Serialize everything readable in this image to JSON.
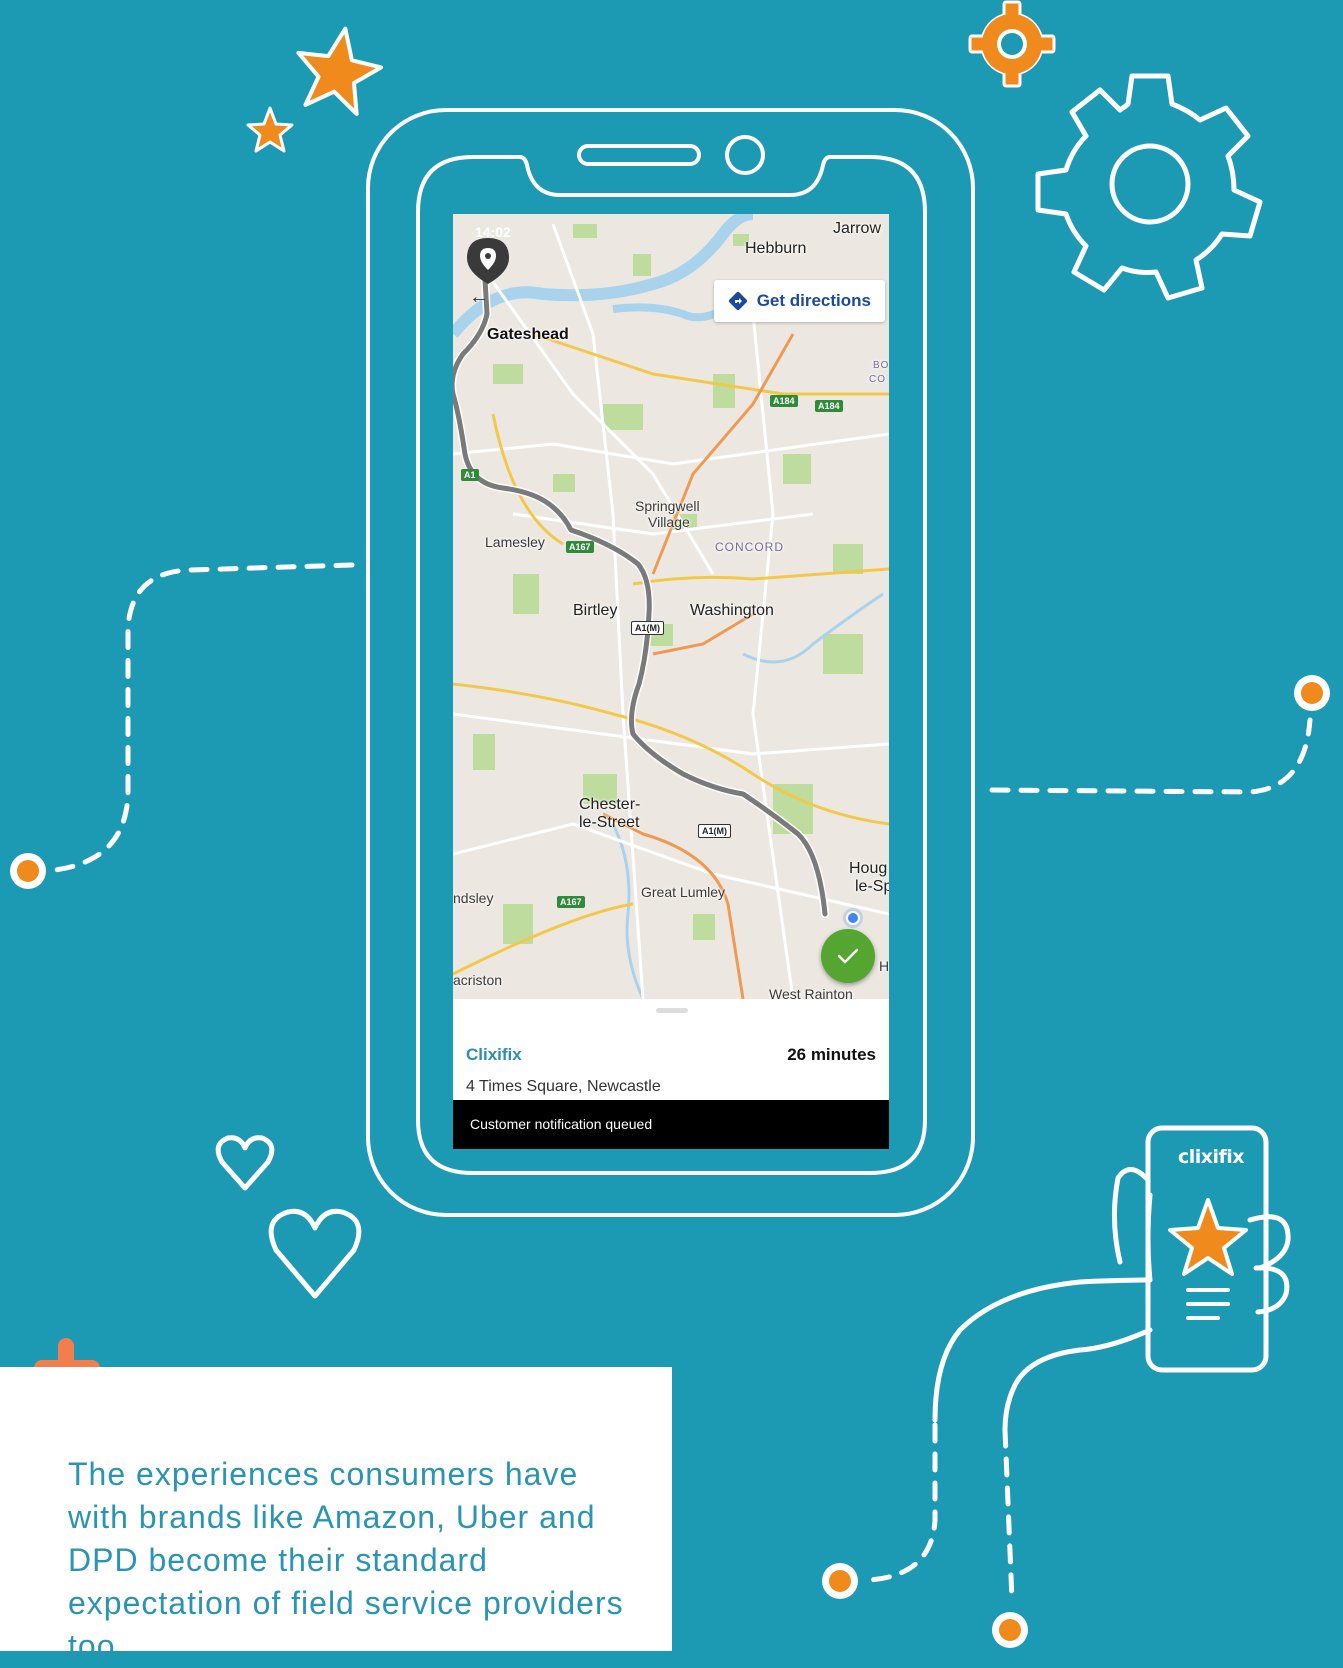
{
  "map": {
    "time": "14:02",
    "labels": {
      "jarrow": "Jarrow",
      "hebburn": "Hebburn",
      "gateshead": "Gateshead",
      "springwell": "Springwell",
      "village": "Village",
      "lamesley": "Lamesley",
      "concord": "CONCORD",
      "birtley": "Birtley",
      "washington": "Washington",
      "chester1": "Chester-",
      "chester2": "le-Street",
      "hough1": "Houg",
      "hough2": "le-Sp",
      "great_lumley": "Great Lumley",
      "ndsley": "ndsley",
      "acriston": "acriston",
      "west_rainton": "West Rainton",
      "bo": "BO",
      "co": "CO",
      "h": "H"
    },
    "roads": {
      "a184a": "A184",
      "a184b": "A184",
      "a167a": "A167",
      "a167b": "A167",
      "a1": "A1",
      "a1m1": "A1(M)",
      "a1m2": "A1(M)"
    }
  },
  "directions": {
    "label": "Get directions",
    "icon": "directions-diamond-icon"
  },
  "sheet": {
    "brand": "Clixifix",
    "eta": "26 minutes",
    "address": "4 Times Square, Newcastle"
  },
  "toast": {
    "message": "Customer notification queued"
  },
  "hand_phone": {
    "logo": "clixifix"
  },
  "card": {
    "text": "The experiences consumers have with brands like Amazon, Uber and DPD become their standard expectation of field service providers too"
  },
  "colors": {
    "background": "#1c9ab3",
    "accent_orange": "#f18a1c",
    "brand_blue": "#2a8fb0",
    "check_green": "#55a630"
  }
}
